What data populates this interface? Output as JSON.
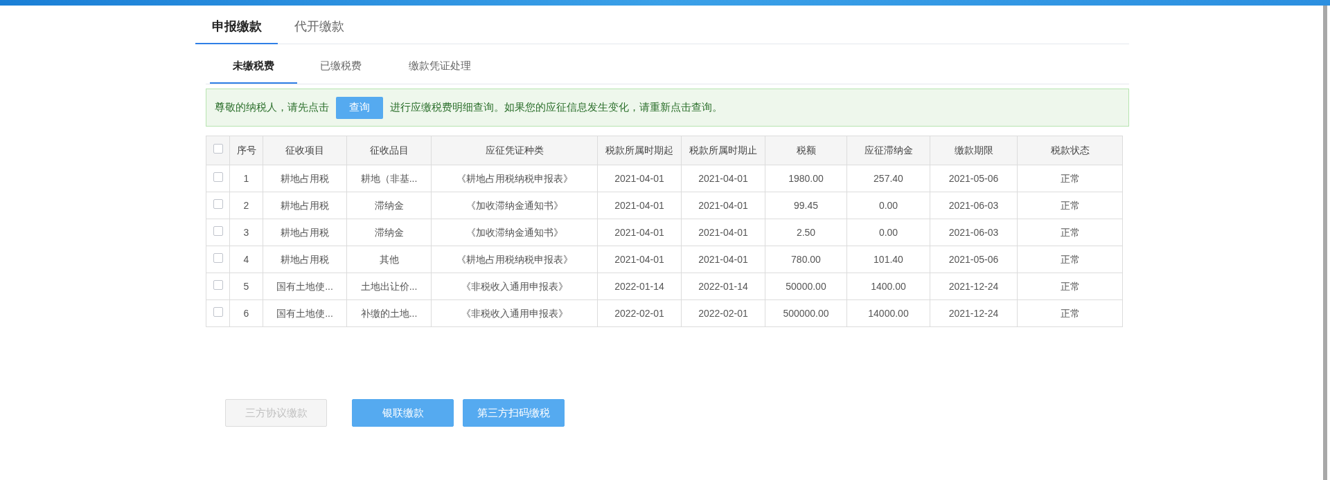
{
  "main_tabs": [
    {
      "label": "申报缴款",
      "selected": true
    },
    {
      "label": "代开缴款",
      "selected": false
    }
  ],
  "sub_tabs": [
    {
      "label": "未缴税费",
      "selected": true
    },
    {
      "label": "已缴税费",
      "selected": false
    },
    {
      "label": "缴款凭证处理",
      "selected": false
    }
  ],
  "notice": {
    "before": "尊敬的纳税人，请先点击",
    "button": "查询",
    "after": "进行应缴税费明细查询。如果您的应征信息发生变化，请重新点击查询。"
  },
  "table": {
    "select_all_checked": false,
    "columns": [
      "序号",
      "征收项目",
      "征收品目",
      "应征凭证种类",
      "税款所属时期起",
      "税款所属时期止",
      "税额",
      "应征滞纳金",
      "缴款期限",
      "税款状态"
    ],
    "rows": [
      {
        "checked": false,
        "cells": [
          "1",
          "耕地占用税",
          "耕地（非基...",
          "《耕地占用税纳税申报表》",
          "2021-04-01",
          "2021-04-01",
          "1980.00",
          "257.40",
          "2021-05-06",
          "正常"
        ]
      },
      {
        "checked": false,
        "cells": [
          "2",
          "耕地占用税",
          "滞纳金",
          "《加收滞纳金通知书》",
          "2021-04-01",
          "2021-04-01",
          "99.45",
          "0.00",
          "2021-06-03",
          "正常"
        ]
      },
      {
        "checked": false,
        "cells": [
          "3",
          "耕地占用税",
          "滞纳金",
          "《加收滞纳金通知书》",
          "2021-04-01",
          "2021-04-01",
          "2.50",
          "0.00",
          "2021-06-03",
          "正常"
        ]
      },
      {
        "checked": false,
        "cells": [
          "4",
          "耕地占用税",
          "其他",
          "《耕地占用税纳税申报表》",
          "2021-04-01",
          "2021-04-01",
          "780.00",
          "101.40",
          "2021-05-06",
          "正常"
        ]
      },
      {
        "checked": false,
        "cells": [
          "5",
          "国有土地使...",
          "土地出让价...",
          "《非税收入通用申报表》",
          "2022-01-14",
          "2022-01-14",
          "50000.00",
          "1400.00",
          "2021-12-24",
          "正常"
        ]
      },
      {
        "checked": false,
        "cells": [
          "6",
          "国有土地使...",
          "补缴的土地...",
          "《非税收入通用申报表》",
          "2022-02-01",
          "2022-02-01",
          "500000.00",
          "14000.00",
          "2021-12-24",
          "正常"
        ]
      }
    ]
  },
  "actions": [
    {
      "label": "三方协议缴款",
      "disabled": true
    },
    {
      "label": "银联缴款",
      "disabled": false
    },
    {
      "label": "第三方扫码缴税",
      "disabled": false
    }
  ]
}
